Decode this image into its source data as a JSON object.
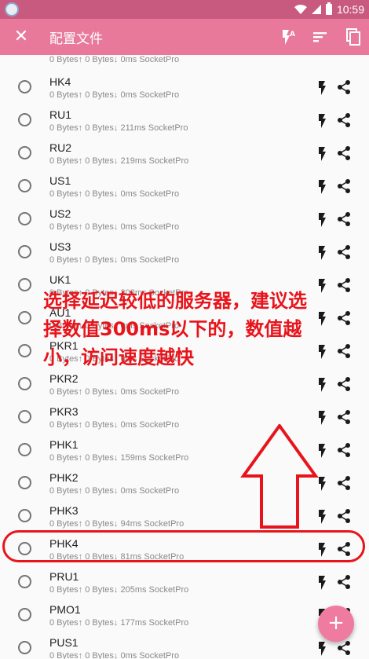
{
  "statusbar": {
    "time": "10:59"
  },
  "appbar": {
    "title": "配置文件",
    "close_icon": "close-icon",
    "actions": [
      "flash-a-icon",
      "sort-icon",
      "copy-icon"
    ]
  },
  "top_partial_row": {
    "stats": "0 Bytes↑ 0 Bytes↓ 0ms SocketPro"
  },
  "servers": [
    {
      "name": "HK4",
      "stats": "0 Bytes↑ 0 Bytes↓ 0ms SocketPro"
    },
    {
      "name": "RU1",
      "stats": "0 Bytes↑ 0 Bytes↓ 211ms SocketPro"
    },
    {
      "name": "RU2",
      "stats": "0 Bytes↑ 0 Bytes↓ 219ms SocketPro"
    },
    {
      "name": "US1",
      "stats": "0 Bytes↑ 0 Bytes↓ 0ms SocketPro"
    },
    {
      "name": "US2",
      "stats": "0 Bytes↑ 0 Bytes↓ 0ms SocketPro"
    },
    {
      "name": "US3",
      "stats": "0 Bytes↑ 0 Bytes↓ 0ms SocketPro"
    },
    {
      "name": "UK1",
      "stats": "0 Bytes↑ 0 Bytes↓ 308ms SocketPro"
    },
    {
      "name": "AU1",
      "stats": "0 Bytes↑ 0 Bytes↓ 0ms SocketPro"
    },
    {
      "name": "PKR1",
      "stats": "0 Bytes↑ 0 Bytes↓ 0ms SocketPro"
    },
    {
      "name": "PKR2",
      "stats": "0 Bytes↑ 0 Bytes↓ 0ms SocketPro"
    },
    {
      "name": "PKR3",
      "stats": "0 Bytes↑ 0 Bytes↓ 0ms SocketPro"
    },
    {
      "name": "PHK1",
      "stats": "0 Bytes↑ 0 Bytes↓ 159ms SocketPro"
    },
    {
      "name": "PHK2",
      "stats": "0 Bytes↑ 0 Bytes↓ 0ms SocketPro"
    },
    {
      "name": "PHK3",
      "stats": "0 Bytes↑ 0 Bytes↓ 94ms SocketPro"
    },
    {
      "name": "PHK4",
      "stats": "0 Bytes↑ 0 Bytes↓ 81ms SocketPro"
    },
    {
      "name": "PRU1",
      "stats": "0 Bytes↑ 0 Bytes↓ 205ms SocketPro"
    },
    {
      "name": "PMO1",
      "stats": "0 Bytes↑ 0 Bytes↓ 177ms SocketPro"
    },
    {
      "name": "PUS1",
      "stats": "0 Bytes↑ 0 Bytes↓ 0ms SocketPro"
    }
  ],
  "annotation": {
    "lines": [
      "选择延迟较低的服务器，建议选",
      "择数值300ms以下的，数值越",
      "小，访问速度越快"
    ]
  },
  "fab": {
    "label": "+"
  },
  "colors": {
    "appbar": "#e8799b",
    "statusbar": "#c95a7f",
    "annotation": "#e8141b",
    "fab": "#ef7ba0"
  }
}
